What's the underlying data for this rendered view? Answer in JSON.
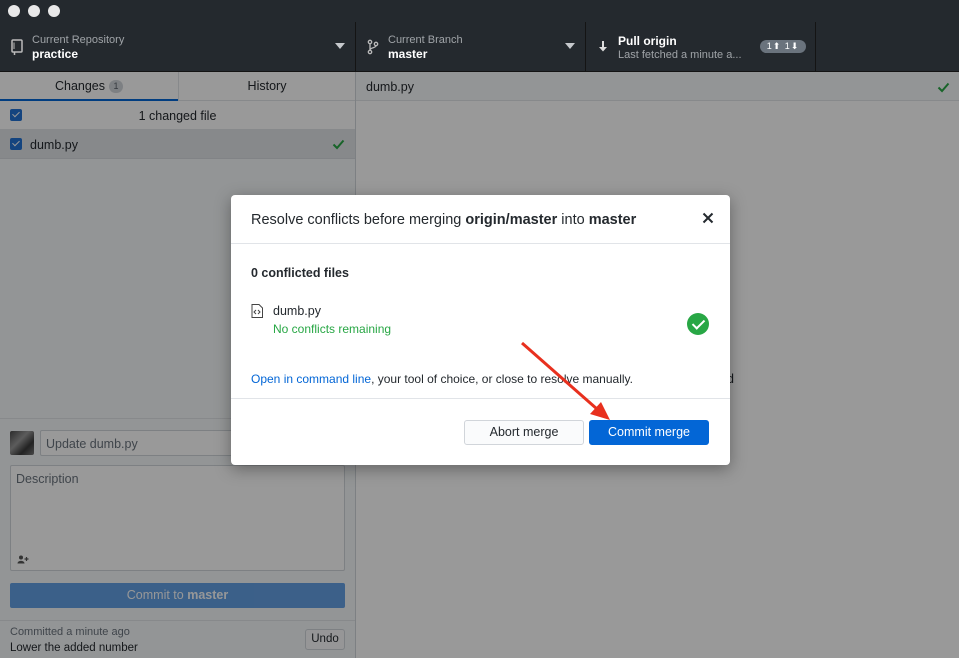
{
  "toolbar": {
    "repo": {
      "label": "Current Repository",
      "value": "practice"
    },
    "branch": {
      "label": "Current Branch",
      "value": "master"
    },
    "pull": {
      "label": "Pull origin",
      "sub": "Last fetched a minute a...",
      "ahead_behind": "1⬆ 1⬇"
    }
  },
  "sidebar": {
    "tabs": [
      {
        "label": "Changes",
        "count": "1"
      },
      {
        "label": "History"
      }
    ],
    "changed_files_header": "1 changed file",
    "files": [
      {
        "name": "dumb.py"
      }
    ],
    "commit": {
      "summary_placeholder": "Update dumb.py",
      "description_placeholder": "Description",
      "button_prefix": "Commit to ",
      "button_branch": "master"
    },
    "last_commit": {
      "time": "Committed a minute ago",
      "message": "Lower the added number",
      "undo_label": "Undo"
    }
  },
  "main": {
    "file_name": "dumb.py",
    "background_fragment": "d"
  },
  "dialog": {
    "title_prefix": "Resolve conflicts before merging ",
    "title_source": "origin/master",
    "title_mid": " into ",
    "title_target": "master",
    "conflict_count": "0 conflicted files",
    "file_name": "dumb.py",
    "file_status": "No conflicts remaining",
    "link_text": "Open in command line",
    "link_suffix": ", your tool of choice, or close to resolve manually.",
    "abort_label": "Abort merge",
    "commit_label": "Commit merge"
  },
  "colors": {
    "accent": "#0366d6",
    "success": "#28a745",
    "annotation_arrow": "#e8301e",
    "titlebar": "#24292e"
  }
}
